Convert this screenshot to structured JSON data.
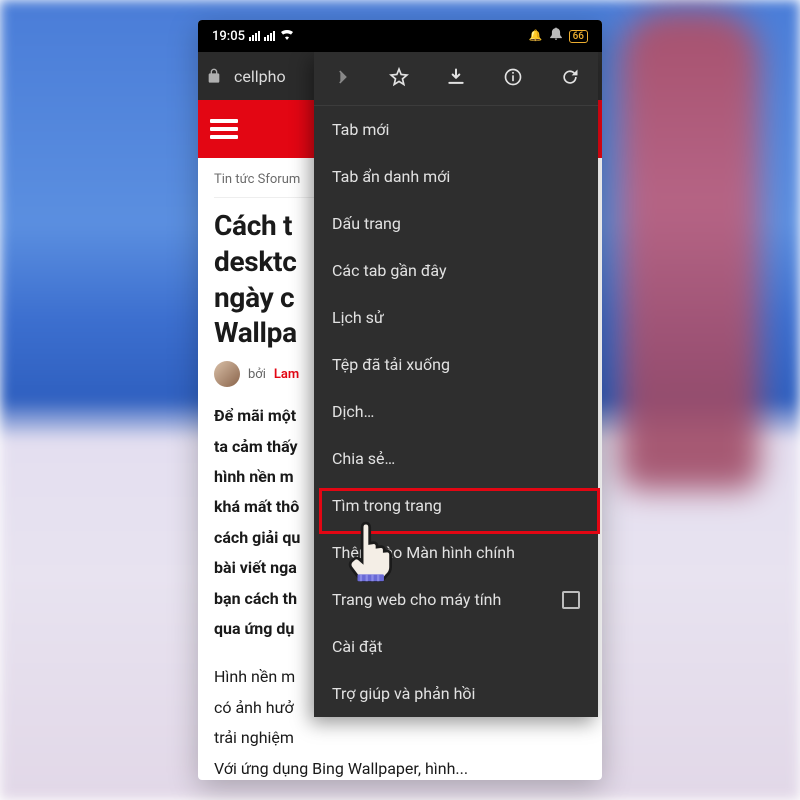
{
  "status": {
    "time": "19:05",
    "battery": "66"
  },
  "url": {
    "text": "cellpho"
  },
  "page": {
    "breadcrumb": "Tin tức Sforum",
    "title": "Cách t\ndesktc\nngày c\nWallpa",
    "by_prefix": "bởi",
    "author": "Lam",
    "body1": "Để mãi một\nta cảm thấy\nhình nền m\nkhá mất thô\ncách giải qu\nbài viết nga\nbạn cách th\nqua ứng dụ",
    "body2": "Hình nền m\ncó ảnh hưở\ntrải nghiệm\nVới ứng dụng Bing Wallpaper, hình..."
  },
  "menu": {
    "items": [
      "Tab mới",
      "Tab ẩn danh mới",
      "Dấu trang",
      "Các tab gần đây",
      "Lịch sử",
      "Tệp đã tải xuống",
      "Dịch…",
      "Chia sẻ…",
      "Tìm trong trang",
      "Thêm vào Màn hình chính",
      "Trang web cho máy tính",
      "Cài đặt",
      "Trợ giúp và phản hồi"
    ]
  }
}
